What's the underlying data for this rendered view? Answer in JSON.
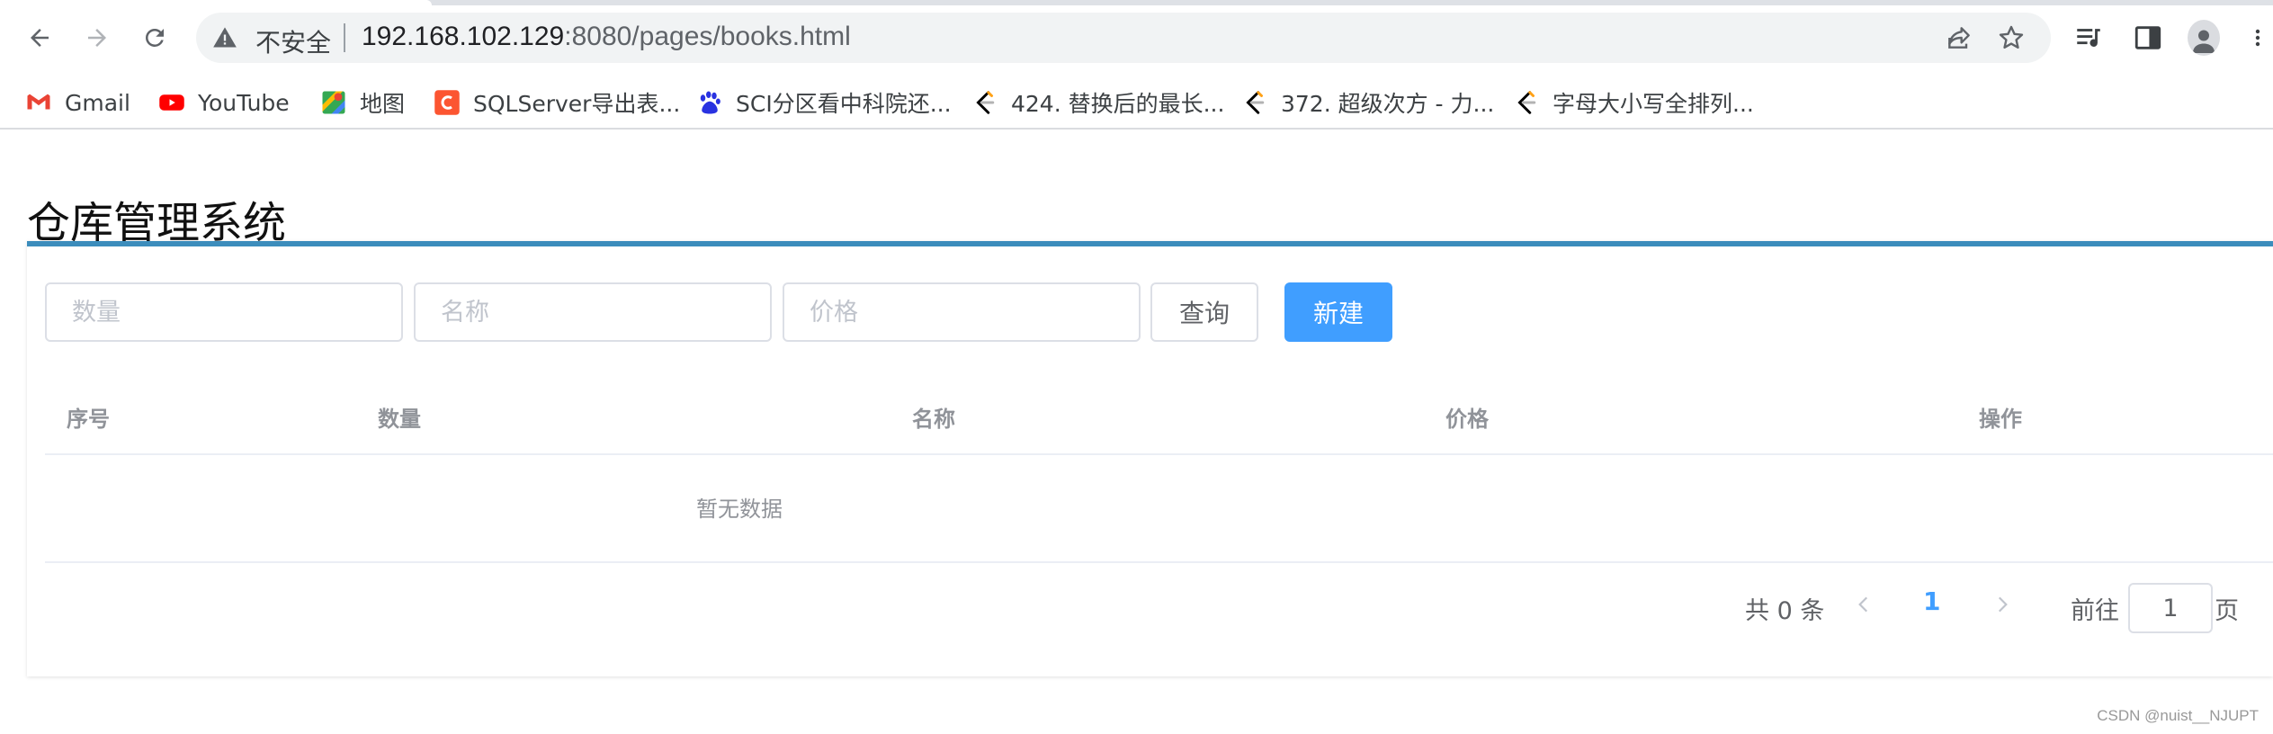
{
  "browser": {
    "insecure_label": "不安全",
    "url_host": "192.168.102.129",
    "url_rest": ":8080/pages/books.html",
    "bookmarks": [
      {
        "label": "Gmail",
        "icon": "gmail-icon"
      },
      {
        "label": "YouTube",
        "icon": "youtube-icon"
      },
      {
        "label": "地图",
        "icon": "maps-icon"
      },
      {
        "label": "SQLServer导出表...",
        "icon": "c-logo-icon"
      },
      {
        "label": "SCI分区看中科院还...",
        "icon": "baidu-icon"
      },
      {
        "label": "424. 替换后的最长...",
        "icon": "leetcode-icon"
      },
      {
        "label": "372. 超级次方 - 力...",
        "icon": "leetcode-icon"
      },
      {
        "label": "字母大小写全排列...",
        "icon": "leetcode-icon"
      }
    ]
  },
  "page": {
    "title": "仓库管理系统",
    "search": {
      "quantity_placeholder": "数量",
      "name_placeholder": "名称",
      "price_placeholder": "价格",
      "query_label": "查询",
      "new_label": "新建"
    },
    "table": {
      "columns": [
        "序号",
        "数量",
        "名称",
        "价格",
        "操作"
      ],
      "empty_text": "暂无数据"
    },
    "pagination": {
      "total_text": "共 0 条",
      "current_page": "1",
      "goto_label": "前往",
      "goto_value": "1",
      "page_suffix": "页"
    },
    "watermark": "CSDN @nuist__NJUPT"
  },
  "colors": {
    "primary": "#409eff",
    "card_top_border": "#3c8dbc"
  }
}
